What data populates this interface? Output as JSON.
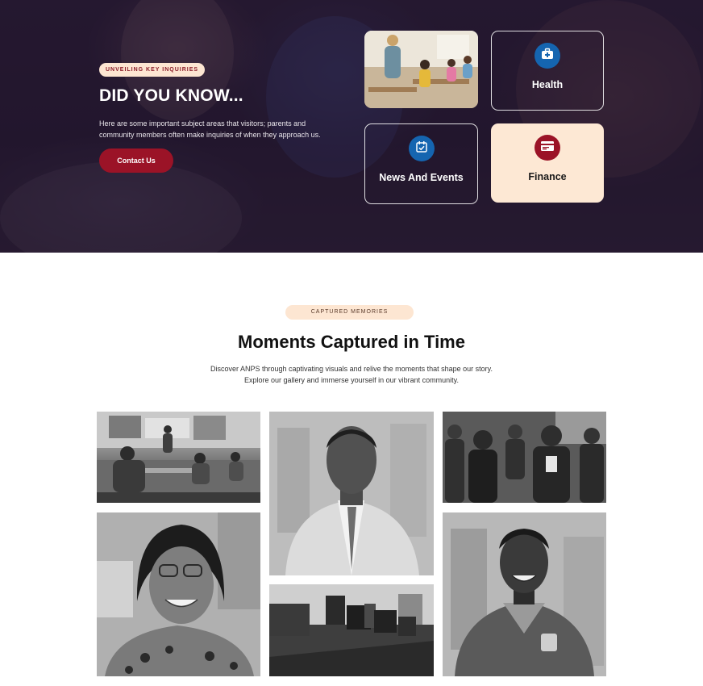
{
  "hero": {
    "eyebrow": "UNVEILING KEY INQUIRIES",
    "title": "DID YOU KNOW...",
    "description": "Here are some important subject areas that visitors; parents and community members often make inquiries of when they approach us.",
    "contact_label": "Contact Us",
    "cards": {
      "health": {
        "label": "Health",
        "icon": "medical-kit-icon"
      },
      "news": {
        "label": "News And Events",
        "icon": "calendar-check-icon"
      },
      "finance": {
        "label": "Finance",
        "icon": "credit-card-icon"
      }
    }
  },
  "memories": {
    "eyebrow": "CAPTURED MEMORIES",
    "title": "Moments Captured in Time",
    "description_line1": "Discover ANPS through captivating visuals and relive the moments that shape our story.",
    "description_line2": "Explore our gallery and immerse yourself in our vibrant community."
  },
  "colors": {
    "accent_red": "#9b1327",
    "accent_blue": "#1565b0",
    "peach": "#fde6d2",
    "hero_dark": "#2a1d35"
  }
}
